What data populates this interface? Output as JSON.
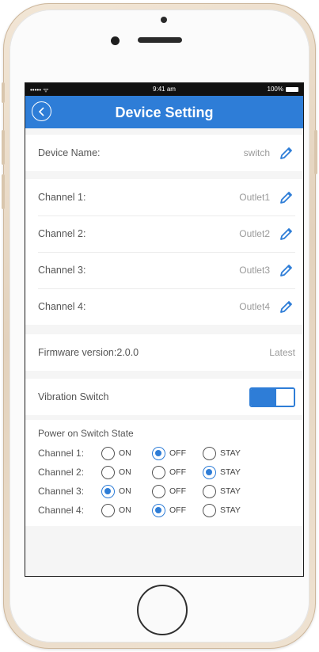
{
  "statusbar": {
    "signal": "••••• ᯤ",
    "time": "9:41 am",
    "battery": "100%"
  },
  "navbar": {
    "title": "Device Setting"
  },
  "device": {
    "label": "Device Name:",
    "value": "switch"
  },
  "channels": [
    {
      "label": "Channel 1:",
      "value": "Outlet1"
    },
    {
      "label": "Channel 2:",
      "value": "Outlet2"
    },
    {
      "label": "Channel 3:",
      "value": "Outlet3"
    },
    {
      "label": "Channel 4:",
      "value": "Outlet4"
    }
  ],
  "firmware": {
    "label": "Firmware version:2.0.0",
    "status": "Latest"
  },
  "vibration": {
    "label": "Vibration Switch",
    "enabled": true
  },
  "power_state": {
    "title": "Power on Switch State",
    "options": [
      "ON",
      "OFF",
      "STAY"
    ],
    "rows": [
      {
        "label": "Channel 1:",
        "selected": "OFF"
      },
      {
        "label": "Channel 2:",
        "selected": "STAY"
      },
      {
        "label": "Channel 3:",
        "selected": "ON"
      },
      {
        "label": "Channel 4:",
        "selected": "OFF"
      }
    ]
  },
  "colors": {
    "accent": "#2e7dd7",
    "background": "#f5f5f5"
  },
  "icons": {
    "back": "chevron-left-circle-icon",
    "edit": "pencil-icon"
  }
}
